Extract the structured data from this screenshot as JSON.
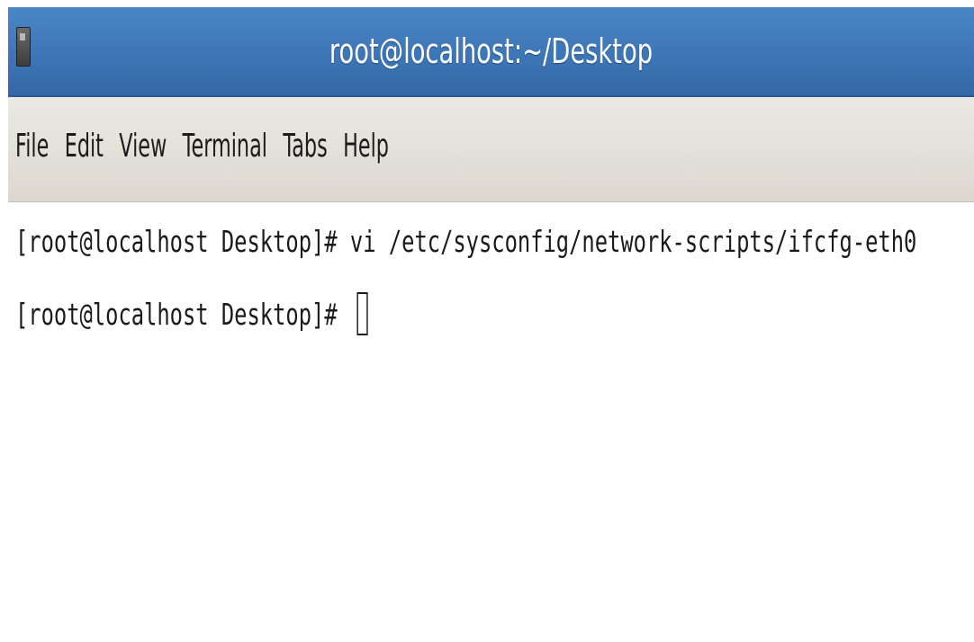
{
  "window": {
    "title": "root@localhost:~/Desktop"
  },
  "menubar": {
    "items": [
      {
        "label": "File"
      },
      {
        "label": "Edit"
      },
      {
        "label": "View"
      },
      {
        "label": "Terminal"
      },
      {
        "label": "Tabs"
      },
      {
        "label": "Help"
      }
    ]
  },
  "terminal": {
    "lines": [
      {
        "prompt": "[root@localhost Desktop]#",
        "command": "vi /etc/sysconfig/network-scripts/ifcfg-eth0"
      },
      {
        "prompt": "[root@localhost Desktop]#",
        "command": ""
      }
    ]
  },
  "colors": {
    "titlebar": "#3d76b7",
    "menubar": "#e4e1db",
    "terminal_bg": "#ffffff",
    "terminal_fg": "#1a1a1a"
  },
  "icons": {
    "app": "terminal-icon"
  }
}
